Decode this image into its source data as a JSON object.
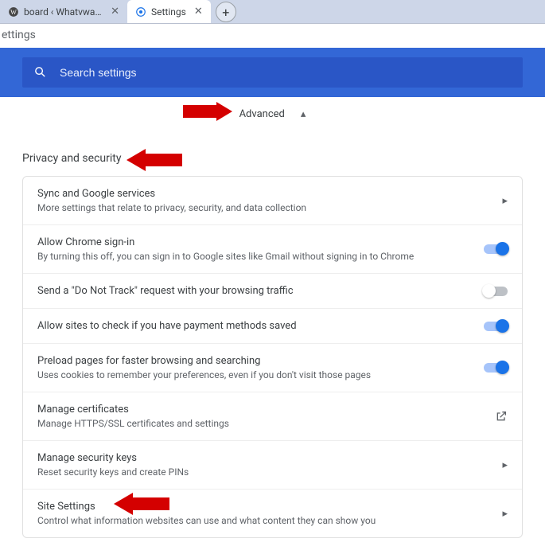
{
  "tabs": {
    "inactive": {
      "label": "board ‹ Whatvwant — Word"
    },
    "active": {
      "label": "Settings"
    }
  },
  "addressbar": "ettings",
  "search": {
    "placeholder": "Search settings"
  },
  "advanced": {
    "label": "Advanced"
  },
  "section": {
    "title": "Privacy and security"
  },
  "rows": {
    "sync": {
      "title": "Sync and Google services",
      "sub": "More settings that relate to privacy, security, and data collection"
    },
    "signin": {
      "title": "Allow Chrome sign-in",
      "sub": "By turning this off, you can sign in to Google sites like Gmail without signing in to Chrome"
    },
    "dnt": {
      "title": "Send a \"Do Not Track\" request with your browsing traffic"
    },
    "payment": {
      "title": "Allow sites to check if you have payment methods saved"
    },
    "preload": {
      "title": "Preload pages for faster browsing and searching",
      "sub": "Uses cookies to remember your preferences, even if you don't visit those pages"
    },
    "certs": {
      "title": "Manage certificates",
      "sub": "Manage HTTPS/SSL certificates and settings"
    },
    "seckeys": {
      "title": "Manage security keys",
      "sub": "Reset security keys and create PINs"
    },
    "site": {
      "title": "Site Settings",
      "sub": "Control what information websites can use and what content they can show you"
    }
  }
}
